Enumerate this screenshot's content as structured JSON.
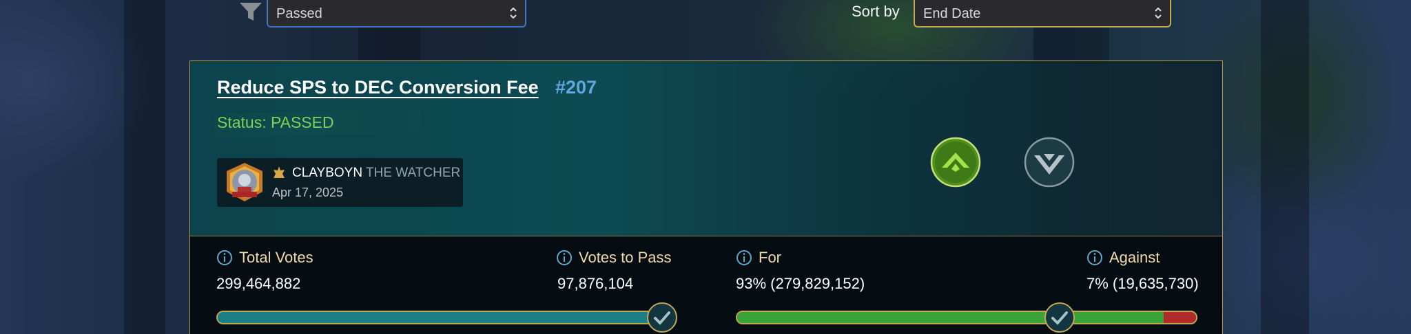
{
  "filter": {
    "status_value": "Passed",
    "sort_label": "Sort by",
    "sort_value": "End Date"
  },
  "proposal": {
    "title": "Reduce SPS to DEC Conversion Fee",
    "number": "#207",
    "status": "Status: PASSED",
    "author": {
      "name": "CLAYBOYN",
      "title": "THE WATCHER",
      "date": "Apr 17, 2025"
    },
    "votes": {
      "up_label": "upvote",
      "down_label": "downvote"
    }
  },
  "stats": {
    "total_votes": {
      "label": "Total Votes",
      "value": "299,464,882"
    },
    "votes_to_pass": {
      "label": "Votes to Pass",
      "value": "97,876,104"
    },
    "for": {
      "label": "For",
      "value": "93% (279,829,152)"
    },
    "against": {
      "label": "Against",
      "value": "7% (19,635,730)"
    }
  },
  "progress": {
    "total_votes_fraction": 1.0,
    "for_percent": 93,
    "against_percent": 7,
    "pass_threshold_marked": true
  },
  "colors": {
    "accent_gold": "#c5a852",
    "for_green": "#3aa33a",
    "against_red": "#b02a2a",
    "total_teal": "#1a7f86",
    "status_green": "#7fd158",
    "number_blue": "#5fa8e0"
  },
  "icons": [
    "filter-icon",
    "chevron-updown-icon",
    "info-icon",
    "crown-icon",
    "upvote-icon",
    "downvote-icon",
    "check-icon"
  ]
}
